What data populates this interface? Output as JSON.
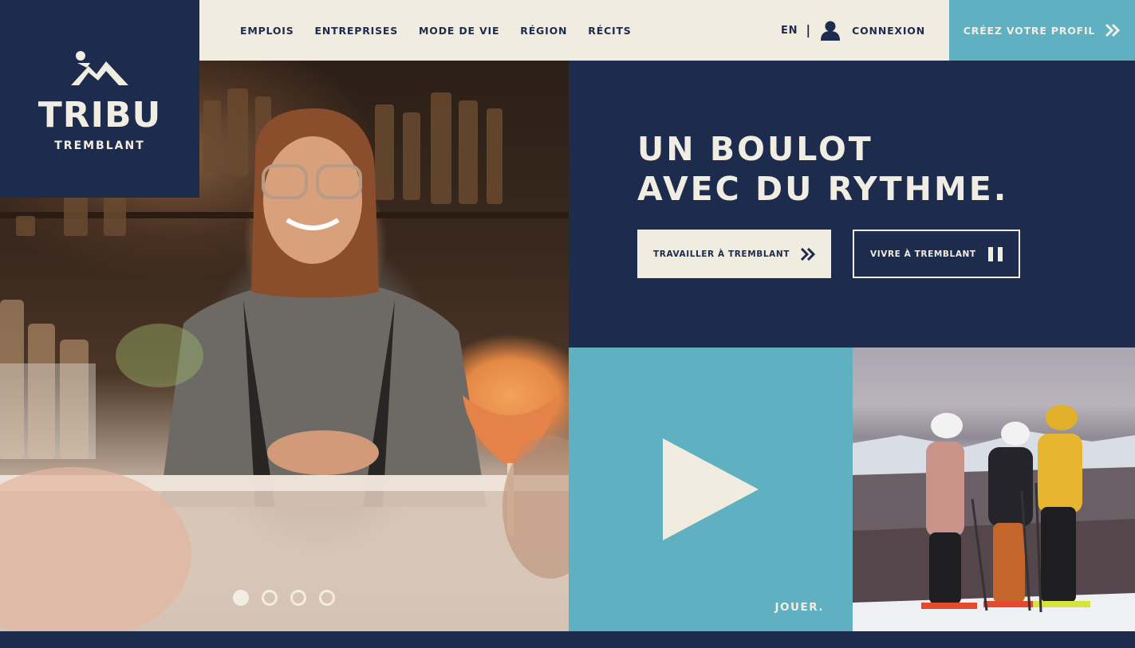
{
  "logo": {
    "title": "TRIBU",
    "subtitle": "TREMBLANT"
  },
  "nav": {
    "items": [
      "EMPLOIS",
      "ENTREPRISES",
      "MODE DE VIE",
      "RÉGION",
      "RÉCITS"
    ],
    "language": "EN",
    "separator": "|",
    "login": "CONNEXION",
    "cta": "CRÉEZ VOTRE PROFIL"
  },
  "hero": {
    "headline_line1": "UN BOULOT",
    "headline_line2": "AVEC DU RYTHME.",
    "primary_button": "TRAVAILLER À TREMBLANT",
    "secondary_button": "VIVRE À TREMBLANT",
    "carousel": {
      "slides": 4,
      "active": 1
    }
  },
  "video": {
    "label": "JOUER."
  },
  "colors": {
    "navy": "#1d2b4c",
    "cream": "#f1ece0",
    "teal": "#5fb1c1"
  },
  "icons": {
    "logo": "mountain-logo-icon",
    "user": "user-icon",
    "cta": "double-chevron-right-icon",
    "pause": "pause-icon",
    "play": "play-icon"
  }
}
